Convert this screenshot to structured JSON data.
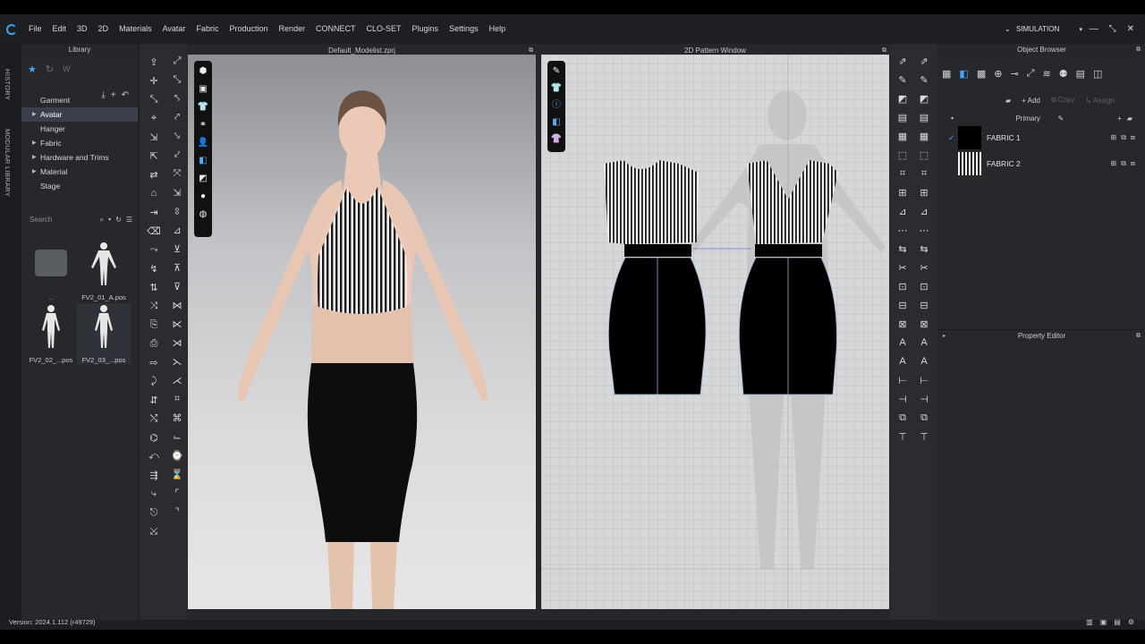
{
  "menu": [
    "File",
    "Edit",
    "3D",
    "2D",
    "Materials",
    "Avatar",
    "Fabric",
    "Production",
    "Render",
    "CONNECT",
    "CLO-SET",
    "Plugins",
    "Settings",
    "Help"
  ],
  "simulation": {
    "label": "SIMULATION",
    "chevron": "⌄",
    "dropdown": "▾"
  },
  "window_controls": [
    "—",
    "⤡",
    "✕"
  ],
  "side_tabs": [
    "HISTORY",
    "MODULAR LIBRARY"
  ],
  "library": {
    "title": "Library",
    "tree": [
      {
        "label": "Garment",
        "expandable": false,
        "selected": false
      },
      {
        "label": "Avatar",
        "expandable": true,
        "selected": true
      },
      {
        "label": "Hanger",
        "expandable": false,
        "selected": false
      },
      {
        "label": "Fabric",
        "expandable": true,
        "selected": false
      },
      {
        "label": "Hardware and Trims",
        "expandable": true,
        "selected": false
      },
      {
        "label": "Material",
        "expandable": true,
        "selected": false
      },
      {
        "label": "Stage",
        "expandable": false,
        "selected": false
      }
    ],
    "actions": [
      "⤓",
      "+",
      "↶"
    ],
    "search_placeholder": "Search",
    "items": [
      {
        "label": "..",
        "kind": "folder"
      },
      {
        "label": "FV2_01_A.pos",
        "kind": "avatar"
      },
      {
        "label": "FV2_02_...pos",
        "kind": "avatar"
      },
      {
        "label": "FV2_03_...pos",
        "kind": "avatar"
      }
    ]
  },
  "viewport3d": {
    "title": "Default_Modelist.zprj"
  },
  "pattern2d": {
    "title": "2D Pattern Window"
  },
  "object_browser": {
    "title": "Object Browser",
    "add": "Add",
    "copy": "Copy",
    "assign": "Assign",
    "group": "Primary",
    "fabrics": [
      {
        "name": "FABRIC 1",
        "swatch": "#000000",
        "checked": true
      },
      {
        "name": "FABRIC 2",
        "swatch": "stripe",
        "checked": false
      }
    ]
  },
  "property_editor": {
    "title": "Property Editor"
  },
  "status": {
    "version": "Version: 2024.1.112 (r49729)"
  }
}
